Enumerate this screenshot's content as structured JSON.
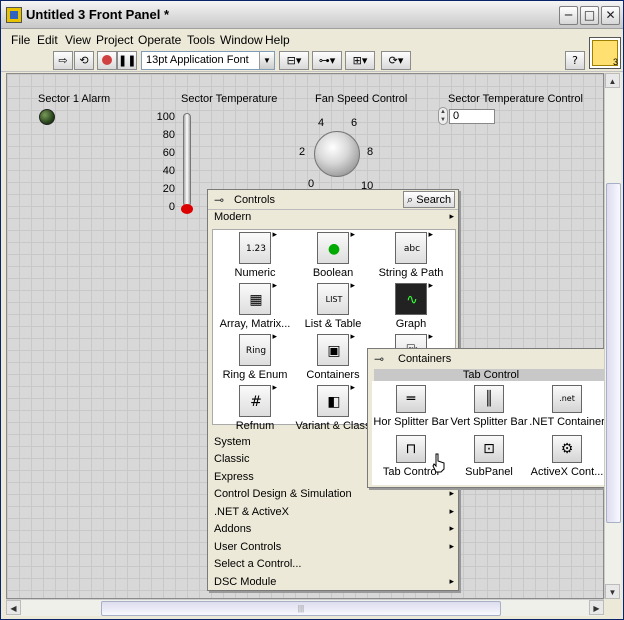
{
  "window": {
    "title": "Untitled 3 Front Panel *",
    "minimize": "─",
    "maximize": "□",
    "close": "✕"
  },
  "menu": [
    "File",
    "Edit",
    "View",
    "Project",
    "Operate",
    "Tools",
    "Window",
    "Help"
  ],
  "toolbar": {
    "font": "13pt Application Font",
    "help": "?",
    "vi_number": "3"
  },
  "panel": {
    "alarm_label": "Sector 1 Alarm",
    "temp_label": "Sector Temperature",
    "temp_ticks": [
      "100",
      "80",
      "60",
      "40",
      "20",
      "0"
    ],
    "fan_label": "Fan Speed Control",
    "fan_ticks": [
      "4",
      "6",
      "2",
      "8",
      "0",
      "10"
    ],
    "control_label": "Sector Temperature Control",
    "control_value": "0"
  },
  "palette": {
    "title": "Controls",
    "search": "Search",
    "modern": "Modern",
    "items": [
      {
        "label": "Numeric",
        "glyph": "1.23"
      },
      {
        "label": "Boolean",
        "glyph": "●"
      },
      {
        "label": "String & Path",
        "glyph": "abc"
      },
      {
        "label": "Array, Matrix...",
        "glyph": "▦"
      },
      {
        "label": "List & Table",
        "glyph": "LIST"
      },
      {
        "label": "Graph",
        "glyph": "∿"
      },
      {
        "label": "Ring & Enum",
        "glyph": "Ring"
      },
      {
        "label": "Containers",
        "glyph": "▣"
      },
      {
        "label": "",
        "glyph": "⎘"
      },
      {
        "label": "Refnum",
        "glyph": "#"
      },
      {
        "label": "Variant & Class",
        "glyph": "◧"
      }
    ],
    "categories": [
      {
        "label": "System",
        "arrow": ""
      },
      {
        "label": "Classic",
        "arrow": ""
      },
      {
        "label": "Express",
        "arrow": ""
      },
      {
        "label": "Control Design & Simulation",
        "arrow": "▸"
      },
      {
        "label": ".NET & ActiveX",
        "arrow": "▸"
      },
      {
        "label": "Addons",
        "arrow": "▸"
      },
      {
        "label": "User Controls",
        "arrow": "▸"
      },
      {
        "label": "Select a Control...",
        "arrow": ""
      },
      {
        "label": "DSC Module",
        "arrow": "▸"
      }
    ]
  },
  "submenu": {
    "title": "Containers",
    "selected": "Tab Control",
    "items": [
      {
        "label": "Hor Splitter Bar",
        "glyph": "═"
      },
      {
        "label": "Vert Splitter Bar",
        "glyph": "║"
      },
      {
        "label": ".NET Container",
        "glyph": ".net"
      },
      {
        "label": "Tab Control",
        "glyph": "⊓"
      },
      {
        "label": "SubPanel",
        "glyph": "⊡"
      },
      {
        "label": "ActiveX Cont...",
        "glyph": "⚙"
      }
    ]
  }
}
